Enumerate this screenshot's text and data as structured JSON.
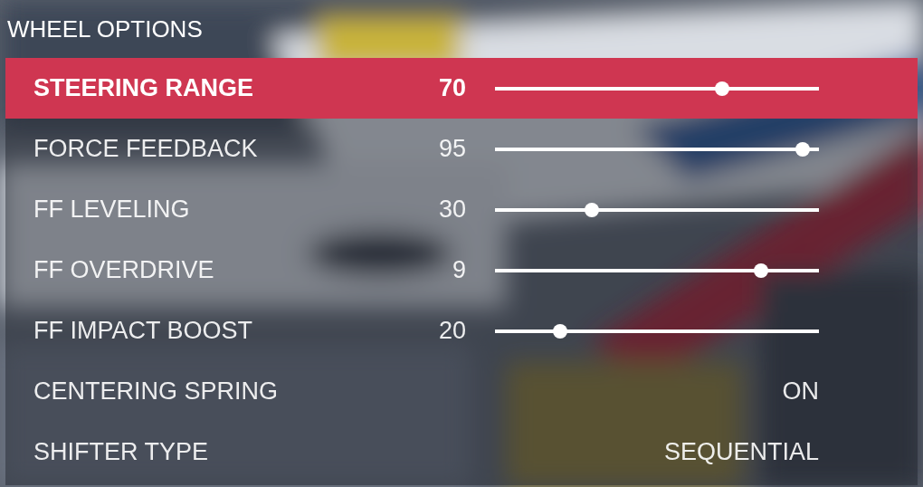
{
  "title": "WHEEL OPTIONS",
  "rows": [
    {
      "kind": "slider",
      "label": "STEERING RANGE",
      "value": "70",
      "level": 0.7,
      "selected": true
    },
    {
      "kind": "slider",
      "label": "FORCE FEEDBACK",
      "value": "95",
      "level": 0.95,
      "selected": false
    },
    {
      "kind": "slider",
      "label": "FF LEVELING",
      "value": "30",
      "level": 0.3,
      "selected": false
    },
    {
      "kind": "slider",
      "label": "FF OVERDRIVE",
      "value": "9",
      "level": 0.82,
      "selected": false
    },
    {
      "kind": "slider",
      "label": "FF IMPACT BOOST",
      "value": "20",
      "level": 0.2,
      "selected": false
    },
    {
      "kind": "option",
      "label": "CENTERING SPRING",
      "value": "ON",
      "selected": false
    },
    {
      "kind": "option",
      "label": "SHIFTER TYPE",
      "value": "SEQUENTIAL",
      "selected": false
    }
  ]
}
